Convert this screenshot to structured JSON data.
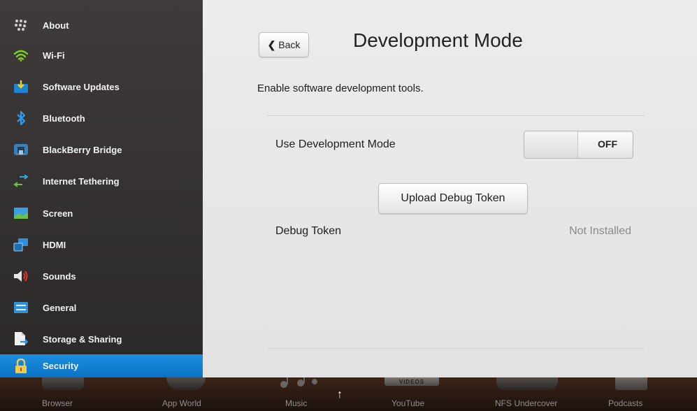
{
  "sidebar": {
    "items": [
      {
        "label": "About",
        "icon": "blackberry-logo-icon"
      },
      {
        "label": "Wi-Fi",
        "icon": "wifi-icon"
      },
      {
        "label": "Software Updates",
        "icon": "software-updates-icon"
      },
      {
        "label": "Bluetooth",
        "icon": "bluetooth-icon"
      },
      {
        "label": "BlackBerry Bridge",
        "icon": "bridge-icon"
      },
      {
        "label": "Internet Tethering",
        "icon": "tethering-icon"
      },
      {
        "label": "Screen",
        "icon": "screen-icon"
      },
      {
        "label": "HDMI",
        "icon": "hdmi-icon"
      },
      {
        "label": "Sounds",
        "icon": "speaker-icon"
      },
      {
        "label": "General",
        "icon": "general-icon"
      },
      {
        "label": "Storage & Sharing",
        "icon": "storage-icon"
      },
      {
        "label": "Security",
        "icon": "lock-icon"
      }
    ],
    "active_item": "Security",
    "accent_color": "#1a8ae0"
  },
  "header": {
    "back_label": "Back",
    "title": "Development Mode"
  },
  "main": {
    "description": "Enable software development tools.",
    "dev_mode_label": "Use Development Mode",
    "dev_mode_state": "OFF",
    "upload_button_label": "Upload Debug Token",
    "debug_token_label": "Debug Token",
    "debug_token_status": "Not Installed"
  },
  "dock": {
    "apps": [
      "Browser",
      "App World",
      "Music",
      "YouTube",
      "NFS Undercover",
      "Podcasts"
    ],
    "youtube_icon_text": "VIDEOS",
    "arrow_icon": "up-arrow-icon"
  }
}
